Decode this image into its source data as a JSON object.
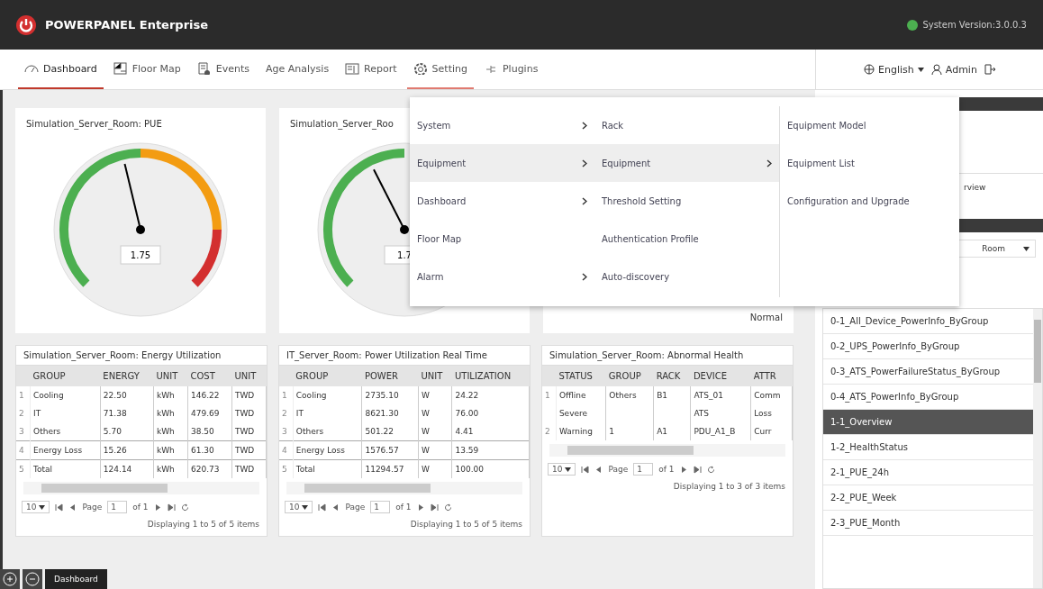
{
  "header": {
    "title": "POWERPANEL Enterprise",
    "version": "System Version:3.0.0.3"
  },
  "nav": {
    "tabs": [
      {
        "label": "Dashboard",
        "selected": true,
        "open": false
      },
      {
        "label": "Floor Map",
        "selected": false,
        "open": false
      },
      {
        "label": "Events",
        "selected": false,
        "open": false
      },
      {
        "label": "Age Analysis",
        "selected": false,
        "open": false
      },
      {
        "label": "Report",
        "selected": false,
        "open": false
      },
      {
        "label": "Setting",
        "selected": false,
        "open": true
      },
      {
        "label": "Plugins",
        "selected": false,
        "open": false
      }
    ],
    "language": "English",
    "user": "Admin"
  },
  "gauges": [
    {
      "title": "Simulation_Server_Room: PUE",
      "value": "1.75",
      "level": 0.45,
      "kind": "full"
    },
    {
      "title": "Simulation_Server_Roo",
      "value": "1.7",
      "level": 0.4,
      "kind": "partial"
    },
    {
      "status": "Normal",
      "kind": "hidden"
    }
  ],
  "tables": [
    {
      "title": "Simulation_Server_Room: Energy Utilization",
      "columns": [
        "",
        "GROUP",
        "ENERGY",
        "UNIT",
        "COST",
        "UNIT"
      ],
      "rows": [
        [
          "1",
          "Cooling",
          "22.50",
          "kWh",
          "146.22",
          "TWD"
        ],
        [
          "2",
          "IT",
          "71.38",
          "kWh",
          "479.69",
          "TWD"
        ],
        [
          "3",
          "Others",
          "5.70",
          "kWh",
          "38.50",
          "TWD"
        ],
        [
          "4",
          "Energy Loss",
          "15.26",
          "kWh",
          "61.30",
          "TWD"
        ],
        [
          "5",
          "Total",
          "124.14",
          "kWh",
          "620.73",
          "TWD"
        ]
      ],
      "page_size": "10",
      "page": "1",
      "of": "of 1",
      "page_label": "Page",
      "summary": "Displaying 1 to 5 of 5 items"
    },
    {
      "title": "IT_Server_Room: Power Utilization Real Time",
      "columns": [
        "",
        "GROUP",
        "POWER",
        "UNIT",
        "UTILIZATION"
      ],
      "rows": [
        [
          "1",
          "Cooling",
          "2735.10",
          "W",
          "24.22"
        ],
        [
          "2",
          "IT",
          "8621.30",
          "W",
          "76.00"
        ],
        [
          "3",
          "Others",
          "501.22",
          "W",
          "4.41"
        ],
        [
          "4",
          "Energy Loss",
          "1576.57",
          "W",
          "13.59"
        ],
        [
          "5",
          "Total",
          "11294.57",
          "W",
          "100.00"
        ]
      ],
      "page_size": "10",
      "page": "1",
      "of": "of 1",
      "page_label": "Page",
      "summary": "Displaying 1 to 5 of 5 items"
    },
    {
      "title": "Simulation_Server_Room: Abnormal Health",
      "columns": [
        "",
        "STATUS",
        "GROUP",
        "RACK",
        "DEVICE",
        "ATTR"
      ],
      "rows": [
        [
          "1",
          "Offline",
          "Others",
          "B1",
          "ATS_01",
          "Comm"
        ],
        [
          "",
          "Severe",
          "",
          "",
          "ATS",
          "Loss"
        ],
        [
          "2",
          "Warning",
          "1",
          "A1",
          "PDU_A1_B",
          "Curr"
        ]
      ],
      "page_size": "10",
      "page": "1",
      "of": "of 1",
      "page_label": "Page",
      "summary": "Displaying 1 to 3 of 3 items"
    }
  ],
  "menu": {
    "columns": [
      [
        {
          "label": "System",
          "arrow": true,
          "selected": false
        },
        {
          "label": "Equipment",
          "arrow": true,
          "selected": true
        },
        {
          "label": "Dashboard",
          "arrow": true,
          "selected": false
        },
        {
          "label": "Floor Map",
          "arrow": false,
          "selected": false
        },
        {
          "label": "Alarm",
          "arrow": true,
          "selected": false
        }
      ],
      [
        {
          "label": "Rack",
          "arrow": false,
          "selected": false
        },
        {
          "label": "Equipment",
          "arrow": true,
          "selected": true
        },
        {
          "label": "Threshold Setting",
          "arrow": false,
          "selected": false
        },
        {
          "label": "Authentication Profile",
          "arrow": false,
          "selected": false
        },
        {
          "label": "Auto-discovery",
          "arrow": false,
          "selected": false
        }
      ],
      [
        {
          "label": "Equipment Model",
          "arrow": false,
          "selected": false
        },
        {
          "label": "Equipment List",
          "arrow": false,
          "selected": false
        },
        {
          "label": "Configuration and Upgrade",
          "arrow": false,
          "selected": false
        }
      ]
    ]
  },
  "side": {
    "partial_text": "rview",
    "select": "Room",
    "items": [
      {
        "label": "0-1_All_Device_PowerInfo_ByGroup",
        "selected": false
      },
      {
        "label": "0-2_UPS_PowerInfo_ByGroup",
        "selected": false
      },
      {
        "label": "0-3_ATS_PowerFailureStatus_ByGroup",
        "selected": false
      },
      {
        "label": "0-4_ATS_PowerInfo_ByGroup",
        "selected": false
      },
      {
        "label": "1-1_Overview",
        "selected": true
      },
      {
        "label": "1-2_HealthStatus",
        "selected": false
      },
      {
        "label": "2-1_PUE_24h",
        "selected": false
      },
      {
        "label": "2-2_PUE_Week",
        "selected": false
      },
      {
        "label": "2-3_PUE_Month",
        "selected": false
      }
    ]
  },
  "footer": {
    "tab": "Dashboard"
  }
}
